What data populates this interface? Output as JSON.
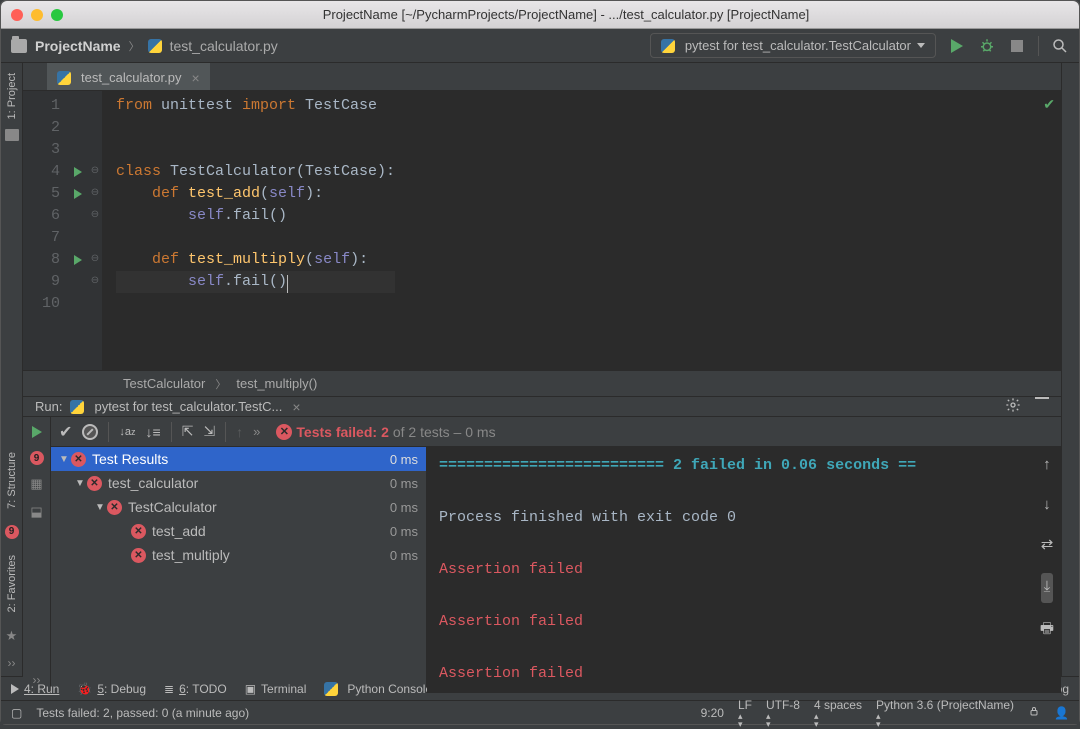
{
  "titlebar": "ProjectName [~/PycharmProjects/ProjectName] - .../test_calculator.py [ProjectName]",
  "breadcrumb": {
    "project": "ProjectName",
    "file": "test_calculator.py"
  },
  "run_config_label": "pytest for test_calculator.TestCalculator",
  "sidebar": {
    "project": "1: Project",
    "structure": "7: Structure",
    "favorites": "2: Favorites"
  },
  "editor_tab": "test_calculator.py",
  "code_lines": [
    "from unittest import TestCase",
    "",
    "",
    "class TestCalculator(TestCase):",
    "    def test_add(self):",
    "        self.fail()",
    "",
    "    def test_multiply(self):",
    "        self.fail()",
    ""
  ],
  "line_numbers": [
    "1",
    "2",
    "3",
    "4",
    "5",
    "6",
    "7",
    "8",
    "9",
    "10"
  ],
  "struct_crumb": {
    "a": "TestCalculator",
    "b": "test_multiply()"
  },
  "run_panel": {
    "label": "Run:",
    "tab": "pytest for test_calculator.TestC...",
    "status_prefix": "Tests failed: ",
    "status_fail_count": "2",
    "status_rest": " of 2 tests – 0 ms"
  },
  "test_tree": {
    "root": {
      "name": "Test Results",
      "time": "0 ms"
    },
    "items": [
      {
        "name": "test_calculator",
        "time": "0 ms",
        "indent": 1
      },
      {
        "name": "TestCalculator",
        "time": "0 ms",
        "indent": 2
      },
      {
        "name": "test_add",
        "time": "0 ms",
        "indent": 3
      },
      {
        "name": "test_multiply",
        "time": "0 ms",
        "indent": 3
      }
    ]
  },
  "console": {
    "summary": "========================= 2 failed in 0.06 seconds ==",
    "exit": "Process finished with exit code 0",
    "errs": [
      "Assertion failed",
      "Assertion failed",
      "Assertion failed"
    ]
  },
  "bottom_tabs": {
    "run": "4: Run",
    "debug": "5: Debug",
    "todo": "6: TODO",
    "terminal": "Terminal",
    "console": "Python Console",
    "event_log": "Event Log"
  },
  "status": {
    "left": "Tests failed: 2, passed: 0 (a minute ago)",
    "pos": "9:20",
    "sep": "LF",
    "enc": "UTF-8",
    "indent": "4 spaces",
    "python": "Python 3.6 (ProjectName)"
  }
}
